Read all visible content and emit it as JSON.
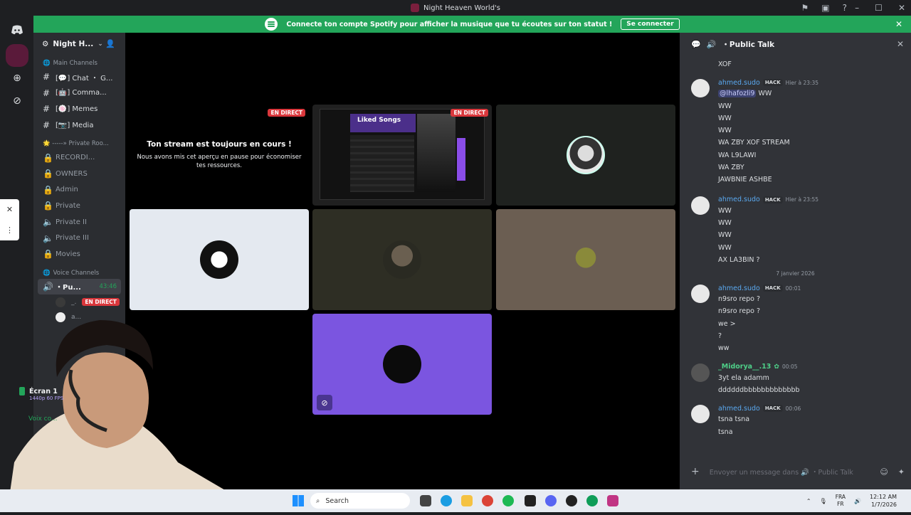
{
  "window": {
    "title": "Night Heaven World's"
  },
  "banner": {
    "text": "Connecte ton compte Spotify pour afficher la musique que tu écoutes sur ton statut !",
    "button": "Se connecter"
  },
  "sidebar": {
    "server_name": "Night H...",
    "main_category": "Main Channels",
    "text_channels": [
      {
        "label": "[💬] Chat ・ G..."
      },
      {
        "label": "[🤖] Comma..."
      },
      {
        "label": "[🍥] Memes"
      },
      {
        "label": "[📷] Media"
      }
    ],
    "private_category": "🌟 -----» Private Roo...",
    "private_channels": [
      {
        "label": "RECORDI..."
      },
      {
        "label": "OWNERS"
      },
      {
        "label": "Admin"
      },
      {
        "label": "Private"
      },
      {
        "label": "Private II"
      },
      {
        "label": "Private III"
      },
      {
        "label": "Movies"
      }
    ],
    "voice_category": "Voice Channels",
    "active_voice": {
      "label": "・Pu...",
      "timer": "43:46"
    },
    "voice_users": [
      {
        "name": "_.",
        "badge": "EN DIRECT"
      },
      {
        "name": "a..."
      }
    ]
  },
  "stream_panel": {
    "screen_label": "Écran 1",
    "quality": "1440p 60 FPS",
    "voice_status": "Voix co..."
  },
  "stage": {
    "paused_title": "Ton stream est toujours en cours !",
    "paused_desc": "Nous avons mis cet aperçu en pause pour économiser tes ressources.",
    "live_badge": "EN DIRECT",
    "liked_songs": "Liked Songs"
  },
  "chat": {
    "channel": "・Public Talk",
    "top_line": "XOF",
    "groups": [
      {
        "author": "ahmed.sudo",
        "tag": "HACK",
        "time": "Hier à 23:35",
        "mention": "@lhafozli9",
        "lines": [
          "WW",
          "WW",
          "WW",
          "WW",
          "WA ZBY XOF STREAM",
          "WA L9LAWI",
          "WA ZBY",
          "JAWBNIE ASHBE"
        ]
      },
      {
        "author": "ahmed.sudo",
        "tag": "HACK",
        "time": "Hier à 23:55",
        "lines": [
          "WW",
          "WW",
          "WW",
          "WW",
          "AX LA3BIN ?"
        ]
      }
    ],
    "date_divider": "7 janvier 2026",
    "groups2": [
      {
        "author": "ahmed.sudo",
        "tag": "HACK",
        "time": "00:01",
        "lines": [
          "n9sro repo ?",
          "n9sro repo ?",
          "we >",
          "?",
          "ww"
        ]
      },
      {
        "author": "_Midorya__.13",
        "time": "00:05",
        "lines": [
          "3yt ela adamm",
          "ddddddbbbbbbbbbbbbb"
        ]
      },
      {
        "author": "ahmed.sudo",
        "tag": "HACK",
        "time": "00:06",
        "lines": [
          "tsna tsna",
          "tsna"
        ]
      }
    ],
    "composer_placeholder": "Envoyer un message dans 🔊 ・Public Talk"
  },
  "taskbar": {
    "search": "Search",
    "lang_top": "FRA",
    "lang_bottom": "FR",
    "time": "12:12 AM",
    "date": "1/7/2026"
  },
  "colors": {
    "accent_green": "#23a55a",
    "live_red": "#da373c",
    "author_blue": "#5aa9f0",
    "tile_purple": "#7b55e0"
  }
}
